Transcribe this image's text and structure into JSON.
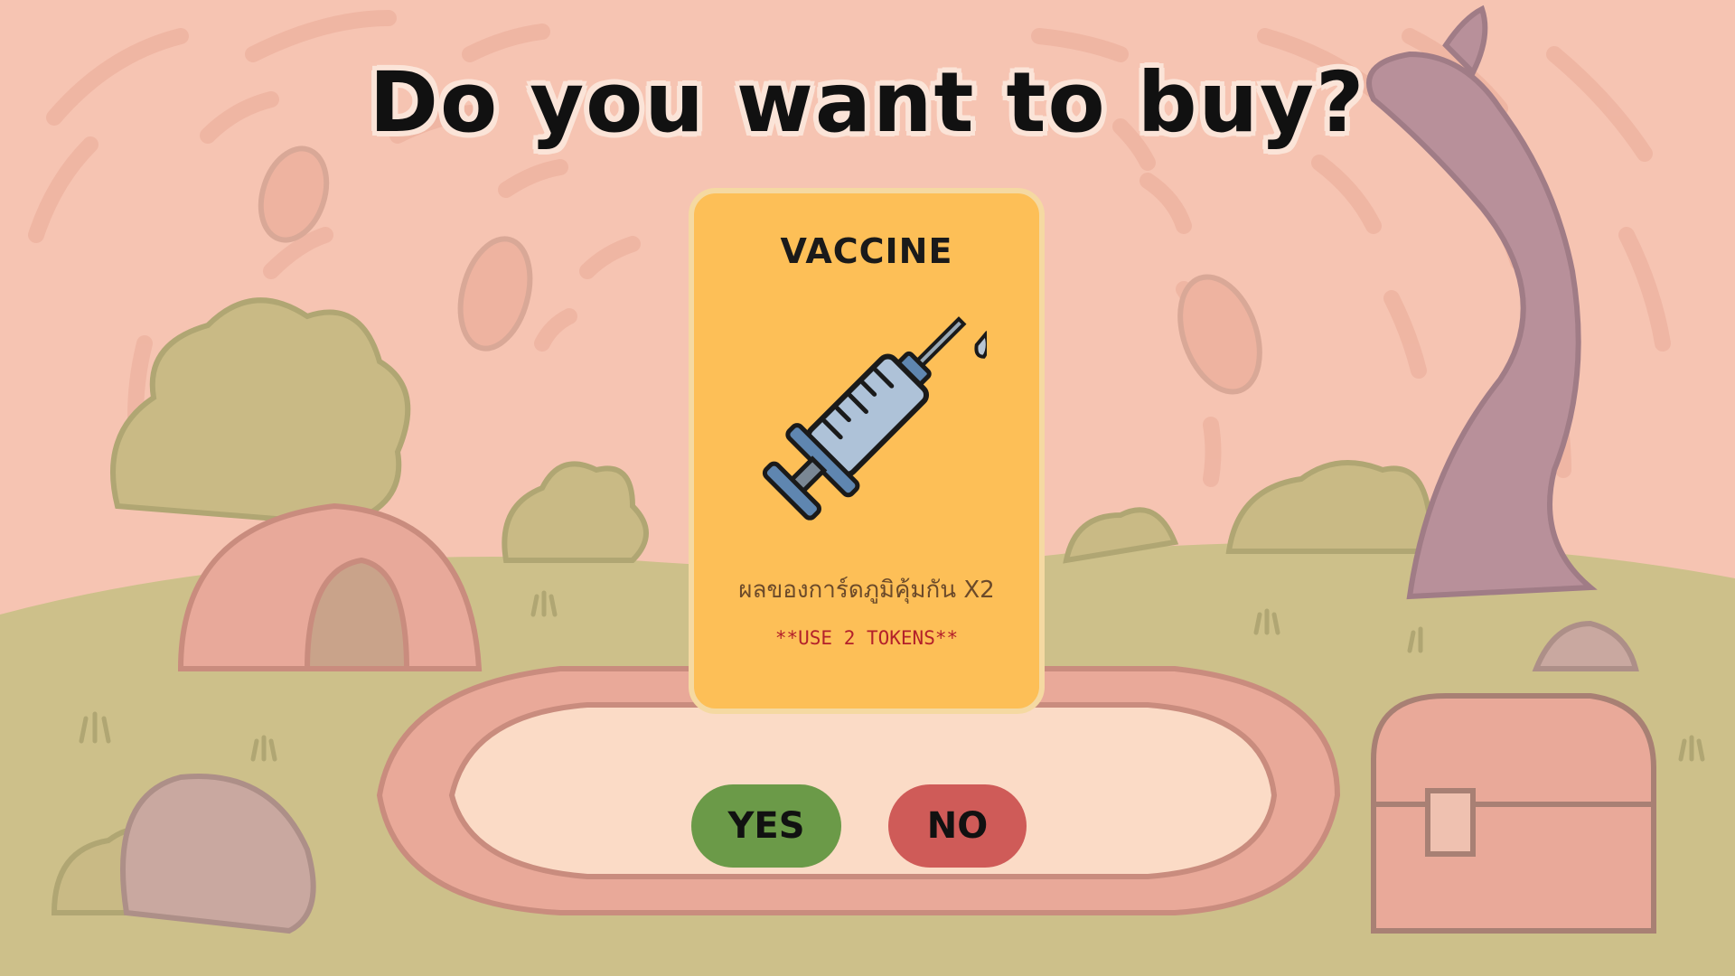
{
  "dialog": {
    "title": "Do you want to buy?"
  },
  "card": {
    "name": "VACCINE",
    "icon": "syringe-icon",
    "effect": "ผลของการ์ดภูมิคุ้มกัน X2",
    "cost": "**USE 2 TOKENS**"
  },
  "actions": {
    "yes_label": "YES",
    "no_label": "NO"
  },
  "colors": {
    "card_background": "#fdbf57",
    "yes_button": "#6b9a48",
    "no_button": "#cf5b58",
    "sky": "#f6c4b2",
    "grass": "#cdc08a"
  }
}
